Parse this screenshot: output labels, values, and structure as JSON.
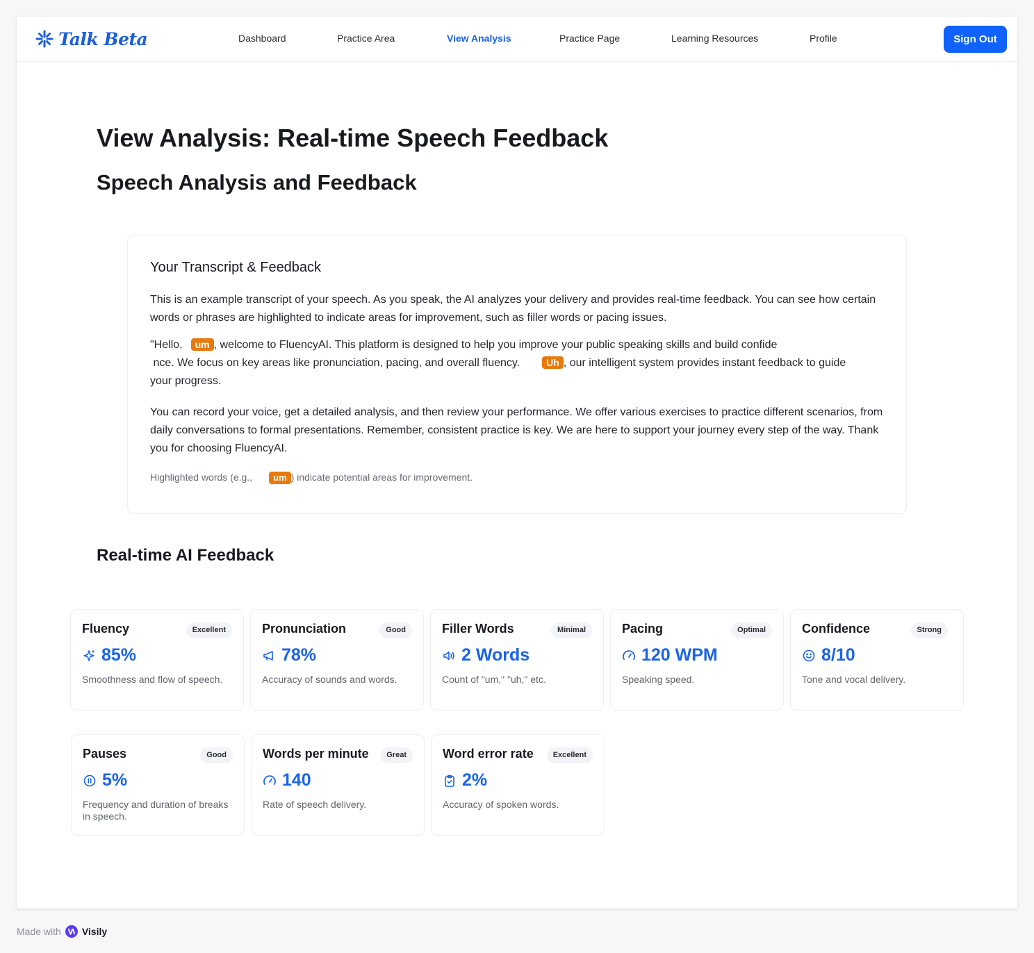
{
  "brand": {
    "name": "Talk Beta",
    "accent": "#1b64e8",
    "logo_icon": "asterisk-logo-icon"
  },
  "nav": {
    "items": [
      {
        "label": "Dashboard",
        "active": false
      },
      {
        "label": "Practice Area",
        "active": false
      },
      {
        "label": "View Analysis",
        "active": true
      },
      {
        "label": "Practice Page",
        "active": false
      },
      {
        "label": "Learning Resources",
        "active": false
      },
      {
        "label": "Profile",
        "active": false
      }
    ],
    "signout_label": "Sign Out"
  },
  "page": {
    "title": "View Analysis: Real-time Speech Feedback",
    "subtitle": "Speech Analysis and Feedback"
  },
  "transcript": {
    "title": "Your Transcript & Feedback",
    "intro_line1": "This is an example transcript of your speech. As you speak, the AI analyzes your delivery and provides real-time feedback. You can see how certain",
    "intro_line2": "words or phrases are highlighted to indicate areas for improvement, such as filler words or pacing issues.",
    "quote_a": "\"Hello,",
    "filler_1": "um",
    "quote_b": ", welcome to FluencyAI. This platform is designed to help you improve your public speaking skills and build confide",
    "quote_c": " nce. We focus on key areas like pronunciation, pacing, and overall fluency.",
    "filler_2": "Uh",
    "quote_d": ", our intelligent system provides instant feedback to guide",
    "quote_e": "your progress.",
    "para2_line1": "You can record your voice, get a detailed analysis, and then review your performance. We offer various exercises to practice different scenarios, from",
    "para2_line2": "daily conversations to formal presentations. Remember, consistent practice is key. We are here to support your journey every step of the way. Thank",
    "para2_line3": "you for choosing FluencyAI.",
    "note_a": "Highlighted words (e.g.,",
    "note_tag": "um",
    "note_b": ") indicate potential areas for improvement.",
    "highlight_color": "#e8790c"
  },
  "feedback": {
    "title": "Real-time AI Feedback",
    "cards": [
      {
        "title": "Fluency",
        "badge": "Excellent",
        "value": "85%",
        "icon": "sparkle-icon",
        "desc": "Smoothness and flow of speech."
      },
      {
        "title": "Pronunciation",
        "badge": "Good",
        "value": "78%",
        "icon": "megaphone-icon",
        "desc": "Accuracy of sounds and words."
      },
      {
        "title": "Filler Words",
        "badge": "Minimal",
        "value": "2 Words",
        "icon": "volume-icon",
        "desc": "Count of \"um,\" \"uh,\" etc."
      },
      {
        "title": "Pacing",
        "badge": "Optimal",
        "value": "120 WPM",
        "icon": "gauge-icon",
        "desc": "Speaking speed."
      },
      {
        "title": "Confidence",
        "badge": "Strong",
        "value": "8/10",
        "icon": "smile-icon",
        "desc": "Tone and vocal delivery."
      },
      {
        "title": "Pauses",
        "badge": "Good",
        "value": "5%",
        "icon": "pause-circle-icon",
        "desc": "Frequency and duration of breaks in speech."
      },
      {
        "title": "Words per minute",
        "badge": "Great",
        "value": "140",
        "icon": "gauge-icon",
        "desc": "Rate of speech delivery."
      },
      {
        "title": "Word error rate",
        "badge": "Excellent",
        "value": "2%",
        "icon": "clipboard-check-icon",
        "desc": "Accuracy of spoken words."
      }
    ]
  },
  "footer": {
    "made_with": "Made with",
    "brand": "Visily"
  }
}
